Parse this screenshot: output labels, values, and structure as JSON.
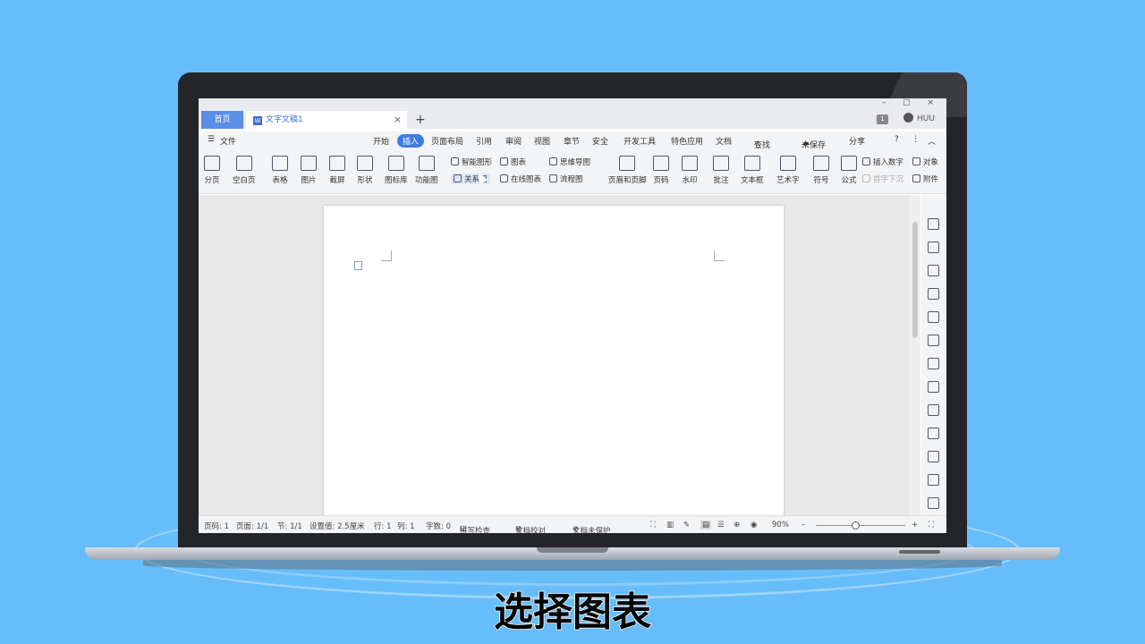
{
  "window": {
    "home_tab": "首页",
    "doc_tab": "文字文稿1",
    "doc_icon": "W",
    "close_glyph": "×",
    "new_tab_glyph": "+",
    "controls": "– ▢ ×",
    "badge": "1",
    "user": "HUU"
  },
  "menubar": {
    "menu_icon": "☰",
    "file": "文件",
    "items": [
      "开始",
      "插入",
      "页面布局",
      "引用",
      "审阅",
      "视图",
      "章节",
      "安全",
      "开发工具",
      "特色应用",
      "文档"
    ],
    "active": "插入",
    "search": "查找",
    "unsaved": "未保存",
    "share": "分享"
  },
  "ribbon": {
    "big": [
      "分页",
      "空白页",
      "表格",
      "图片",
      "截屏",
      "形状",
      "图标库",
      "功能图",
      "页眉和页脚",
      "页码",
      "水印",
      "批注",
      "文本框",
      "艺术字",
      "符号",
      "公式"
    ],
    "small": {
      "smart_graphic": "智能图形",
      "chart": "图表",
      "mindmap": "思维导图",
      "relation": "关系图",
      "online_chart": "在线图表",
      "flowchart": "流程图",
      "insert_number": "插入数字",
      "object": "对象",
      "first_drop": "首字下沉",
      "attachment": "附件"
    }
  },
  "status": {
    "page_num": "页码: 1",
    "pages": "页面: 1/1",
    "section": "节: 1/1",
    "setting": "设置值: 2.5厘米",
    "row": "行: 1",
    "col": "列: 1",
    "words": "字数: 0",
    "spell": "拼写检查",
    "proof": "文档校对",
    "protect": "文档未保护",
    "zoom": "90%",
    "zoom_minus": "–",
    "zoom_plus": "+"
  },
  "caption": "选择图表"
}
